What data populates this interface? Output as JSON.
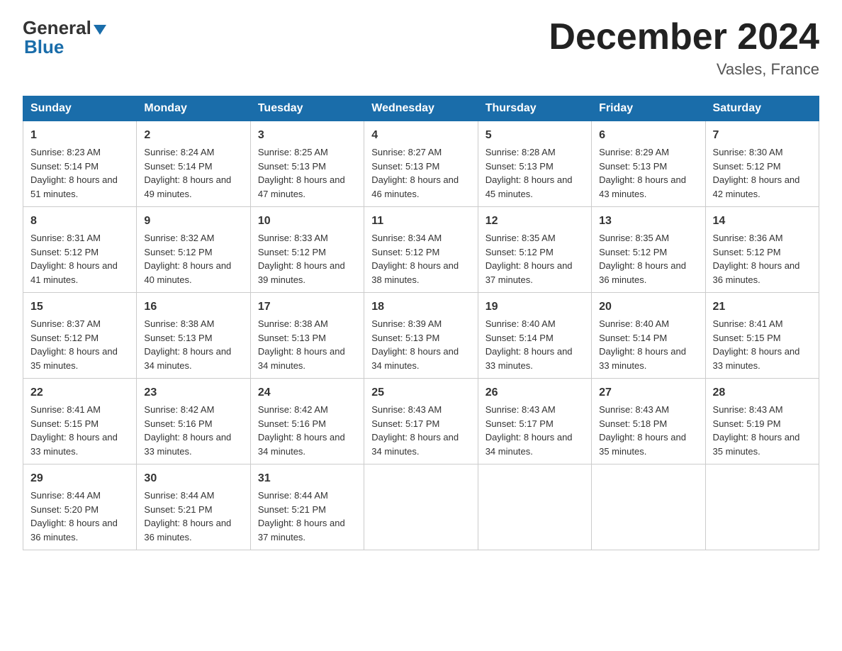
{
  "header": {
    "logo_general": "General",
    "logo_blue": "Blue",
    "month_title": "December 2024",
    "location": "Vasles, France"
  },
  "calendar": {
    "days_of_week": [
      "Sunday",
      "Monday",
      "Tuesday",
      "Wednesday",
      "Thursday",
      "Friday",
      "Saturday"
    ],
    "weeks": [
      [
        {
          "day": "1",
          "sunrise": "8:23 AM",
          "sunset": "5:14 PM",
          "daylight": "8 hours and 51 minutes."
        },
        {
          "day": "2",
          "sunrise": "8:24 AM",
          "sunset": "5:14 PM",
          "daylight": "8 hours and 49 minutes."
        },
        {
          "day": "3",
          "sunrise": "8:25 AM",
          "sunset": "5:13 PM",
          "daylight": "8 hours and 47 minutes."
        },
        {
          "day": "4",
          "sunrise": "8:27 AM",
          "sunset": "5:13 PM",
          "daylight": "8 hours and 46 minutes."
        },
        {
          "day": "5",
          "sunrise": "8:28 AM",
          "sunset": "5:13 PM",
          "daylight": "8 hours and 45 minutes."
        },
        {
          "day": "6",
          "sunrise": "8:29 AM",
          "sunset": "5:13 PM",
          "daylight": "8 hours and 43 minutes."
        },
        {
          "day": "7",
          "sunrise": "8:30 AM",
          "sunset": "5:12 PM",
          "daylight": "8 hours and 42 minutes."
        }
      ],
      [
        {
          "day": "8",
          "sunrise": "8:31 AM",
          "sunset": "5:12 PM",
          "daylight": "8 hours and 41 minutes."
        },
        {
          "day": "9",
          "sunrise": "8:32 AM",
          "sunset": "5:12 PM",
          "daylight": "8 hours and 40 minutes."
        },
        {
          "day": "10",
          "sunrise": "8:33 AM",
          "sunset": "5:12 PM",
          "daylight": "8 hours and 39 minutes."
        },
        {
          "day": "11",
          "sunrise": "8:34 AM",
          "sunset": "5:12 PM",
          "daylight": "8 hours and 38 minutes."
        },
        {
          "day": "12",
          "sunrise": "8:35 AM",
          "sunset": "5:12 PM",
          "daylight": "8 hours and 37 minutes."
        },
        {
          "day": "13",
          "sunrise": "8:35 AM",
          "sunset": "5:12 PM",
          "daylight": "8 hours and 36 minutes."
        },
        {
          "day": "14",
          "sunrise": "8:36 AM",
          "sunset": "5:12 PM",
          "daylight": "8 hours and 36 minutes."
        }
      ],
      [
        {
          "day": "15",
          "sunrise": "8:37 AM",
          "sunset": "5:12 PM",
          "daylight": "8 hours and 35 minutes."
        },
        {
          "day": "16",
          "sunrise": "8:38 AM",
          "sunset": "5:13 PM",
          "daylight": "8 hours and 34 minutes."
        },
        {
          "day": "17",
          "sunrise": "8:38 AM",
          "sunset": "5:13 PM",
          "daylight": "8 hours and 34 minutes."
        },
        {
          "day": "18",
          "sunrise": "8:39 AM",
          "sunset": "5:13 PM",
          "daylight": "8 hours and 34 minutes."
        },
        {
          "day": "19",
          "sunrise": "8:40 AM",
          "sunset": "5:14 PM",
          "daylight": "8 hours and 33 minutes."
        },
        {
          "day": "20",
          "sunrise": "8:40 AM",
          "sunset": "5:14 PM",
          "daylight": "8 hours and 33 minutes."
        },
        {
          "day": "21",
          "sunrise": "8:41 AM",
          "sunset": "5:15 PM",
          "daylight": "8 hours and 33 minutes."
        }
      ],
      [
        {
          "day": "22",
          "sunrise": "8:41 AM",
          "sunset": "5:15 PM",
          "daylight": "8 hours and 33 minutes."
        },
        {
          "day": "23",
          "sunrise": "8:42 AM",
          "sunset": "5:16 PM",
          "daylight": "8 hours and 33 minutes."
        },
        {
          "day": "24",
          "sunrise": "8:42 AM",
          "sunset": "5:16 PM",
          "daylight": "8 hours and 34 minutes."
        },
        {
          "day": "25",
          "sunrise": "8:43 AM",
          "sunset": "5:17 PM",
          "daylight": "8 hours and 34 minutes."
        },
        {
          "day": "26",
          "sunrise": "8:43 AM",
          "sunset": "5:17 PM",
          "daylight": "8 hours and 34 minutes."
        },
        {
          "day": "27",
          "sunrise": "8:43 AM",
          "sunset": "5:18 PM",
          "daylight": "8 hours and 35 minutes."
        },
        {
          "day": "28",
          "sunrise": "8:43 AM",
          "sunset": "5:19 PM",
          "daylight": "8 hours and 35 minutes."
        }
      ],
      [
        {
          "day": "29",
          "sunrise": "8:44 AM",
          "sunset": "5:20 PM",
          "daylight": "8 hours and 36 minutes."
        },
        {
          "day": "30",
          "sunrise": "8:44 AM",
          "sunset": "5:21 PM",
          "daylight": "8 hours and 36 minutes."
        },
        {
          "day": "31",
          "sunrise": "8:44 AM",
          "sunset": "5:21 PM",
          "daylight": "8 hours and 37 minutes."
        },
        null,
        null,
        null,
        null
      ]
    ]
  }
}
